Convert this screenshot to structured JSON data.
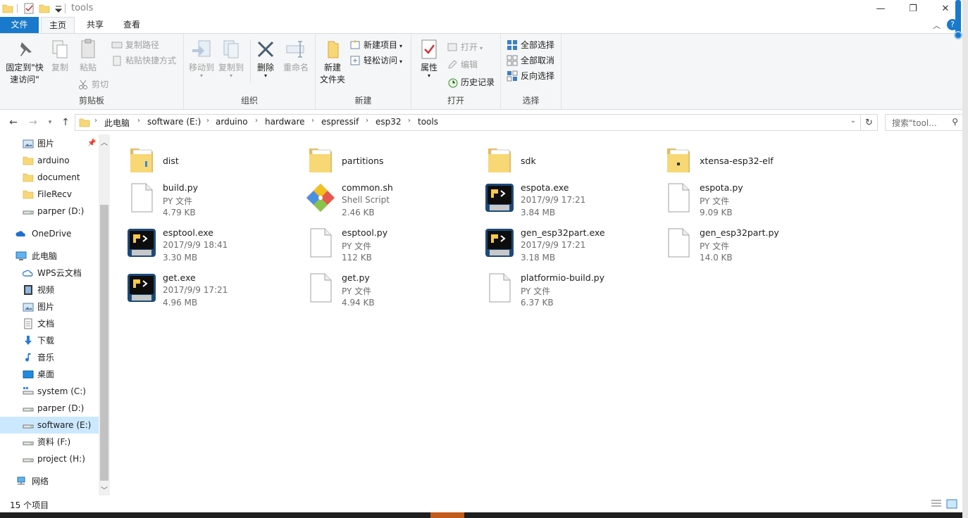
{
  "window": {
    "title": "tools",
    "minimize_glyph": "—",
    "restore_glyph": "❐",
    "close_glyph": "✕",
    "help_glyph": "?"
  },
  "tabs": {
    "file": "文件",
    "home": "主页",
    "share": "共享",
    "view": "查看"
  },
  "ribbon": {
    "clipboard": {
      "pin_line1": "固定到\"快",
      "pin_line2": "速访问\"",
      "copy": "复制",
      "paste": "粘贴",
      "copy_path": "复制路径",
      "paste_shortcut": "粘贴快捷方式",
      "cut": "剪切",
      "label": "剪贴板"
    },
    "organize": {
      "move_to": "移动到",
      "copy_to": "复制到",
      "delete": "删除",
      "rename": "重命名",
      "label": "组织"
    },
    "new": {
      "new_folder_line1": "新建",
      "new_folder_line2": "文件夹",
      "new_item": "新建项目",
      "easy_access": "轻松访问",
      "label": "新建"
    },
    "open": {
      "properties": "属性",
      "open": "打开",
      "edit": "编辑",
      "history": "历史记录",
      "label": "打开"
    },
    "select": {
      "select_all": "全部选择",
      "select_none": "全部取消",
      "invert": "反向选择",
      "label": "选择"
    }
  },
  "address": {
    "crumbs": [
      "此电脑",
      "software (E:)",
      "arduino",
      "hardware",
      "espressif",
      "esp32",
      "tools"
    ],
    "search_placeholder": "搜索\"tool..."
  },
  "nav": {
    "items": [
      {
        "label": "图片",
        "icon": "pictures-icon"
      },
      {
        "label": "arduino",
        "icon": "folder-icon"
      },
      {
        "label": "document",
        "icon": "folder-icon"
      },
      {
        "label": "FileRecv",
        "icon": "folder-icon"
      },
      {
        "label": "parper (D:)",
        "icon": "drive-icon"
      },
      {
        "label": "OneDrive",
        "icon": "onedrive-icon"
      },
      {
        "label": "此电脑",
        "icon": "this-pc-icon"
      },
      {
        "label": "WPS云文档",
        "icon": "cloud-icon"
      },
      {
        "label": "视频",
        "icon": "videos-icon"
      },
      {
        "label": "图片",
        "icon": "pictures-icon"
      },
      {
        "label": "文档",
        "icon": "documents-icon"
      },
      {
        "label": "下载",
        "icon": "downloads-icon"
      },
      {
        "label": "音乐",
        "icon": "music-icon"
      },
      {
        "label": "桌面",
        "icon": "desktop-icon"
      },
      {
        "label": "system (C:)",
        "icon": "system-drive-icon"
      },
      {
        "label": "parper (D:)",
        "icon": "drive-icon"
      },
      {
        "label": "software (E:)",
        "icon": "drive-icon"
      },
      {
        "label": "资料 (F:)",
        "icon": "drive-icon"
      },
      {
        "label": "project (H:)",
        "icon": "drive-icon"
      },
      {
        "label": "网络",
        "icon": "network-icon"
      }
    ]
  },
  "files": [
    {
      "name": "dist",
      "kind": "folder"
    },
    {
      "name": "partitions",
      "kind": "folder"
    },
    {
      "name": "sdk",
      "kind": "folder"
    },
    {
      "name": "xtensa-esp32-elf",
      "kind": "folder"
    },
    {
      "name": "build.py",
      "type": "PY 文件",
      "size": "4.79 KB",
      "kind": "doc"
    },
    {
      "name": "common.sh",
      "type": "Shell Script",
      "size": "2.46 KB",
      "kind": "git"
    },
    {
      "name": "espota.exe",
      "type": "2017/9/9 17:21",
      "size": "3.84 MB",
      "kind": "exe"
    },
    {
      "name": "espota.py",
      "type": "PY 文件",
      "size": "9.09 KB",
      "kind": "doc"
    },
    {
      "name": "esptool.exe",
      "type": "2017/9/9 18:41",
      "size": "3.30 MB",
      "kind": "exe"
    },
    {
      "name": "esptool.py",
      "type": "PY 文件",
      "size": "112 KB",
      "kind": "doc"
    },
    {
      "name": "gen_esp32part.exe",
      "type": "2017/9/9 17:21",
      "size": "3.18 MB",
      "kind": "exe"
    },
    {
      "name": "gen_esp32part.py",
      "type": "PY 文件",
      "size": "14.0 KB",
      "kind": "doc"
    },
    {
      "name": "get.exe",
      "type": "2017/9/9 17:21",
      "size": "4.96 MB",
      "kind": "exe"
    },
    {
      "name": "get.py",
      "type": "PY 文件",
      "size": "4.94 KB",
      "kind": "doc"
    },
    {
      "name": "platformio-build.py",
      "type": "PY 文件",
      "size": "6.37 KB",
      "kind": "doc"
    }
  ],
  "status": {
    "count": "15 个项目"
  },
  "colors": {
    "accent": "#1979ca",
    "folder": "#f8d775",
    "selected": "#cce8ff"
  }
}
